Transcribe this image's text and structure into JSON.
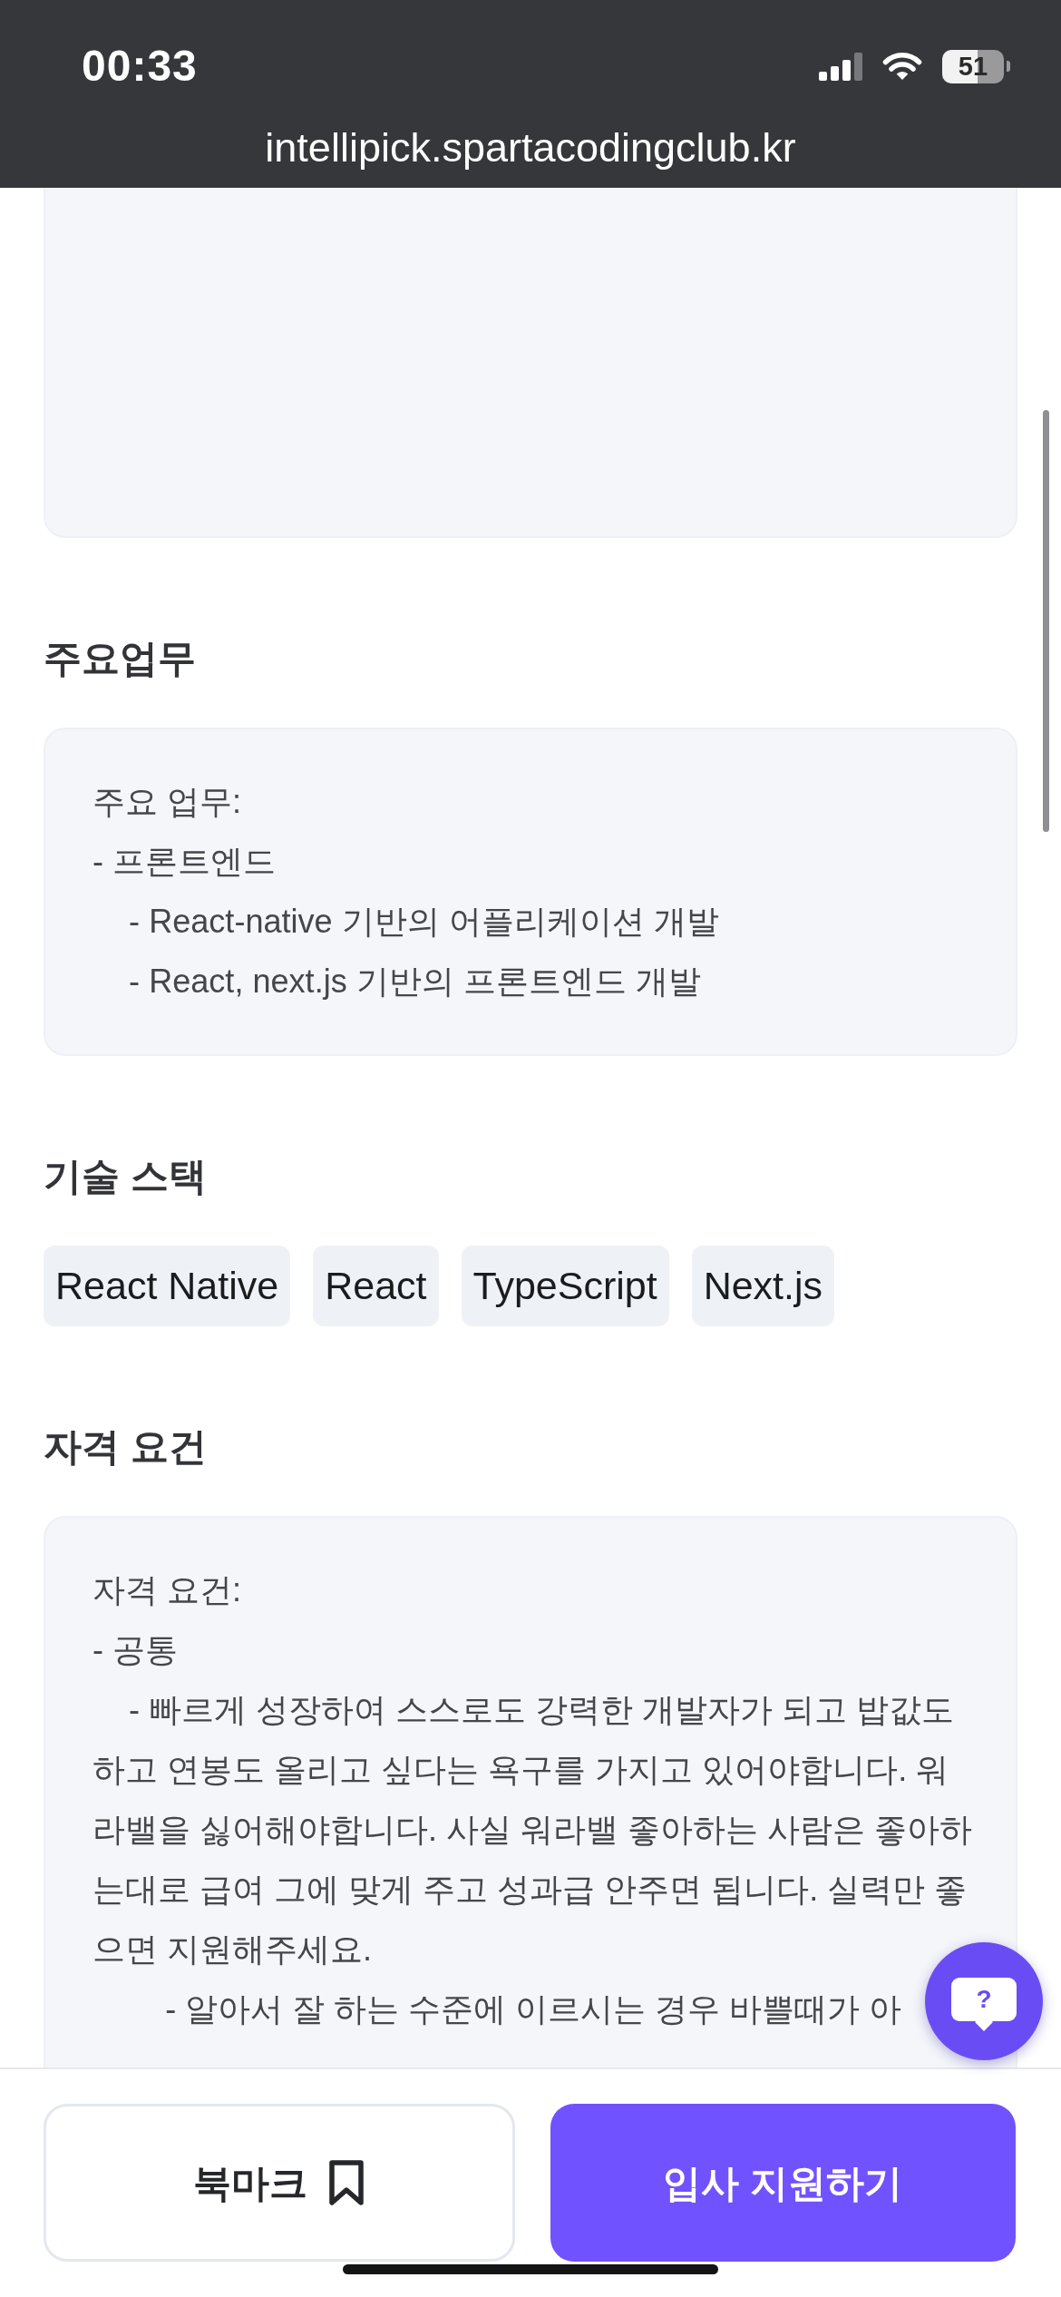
{
  "status_bar": {
    "time": "00:33",
    "battery": "51",
    "url": "intellipick.spartacodingclub.kr"
  },
  "sections": [
    {
      "kind": "card"
    },
    {
      "kind": "card",
      "heading": "주요업무",
      "lines": [
        "주요 업무:",
        "- 프론트엔드",
        "    - React-native 기반의 어플리케이션 개발",
        "    - React, next.js 기반의 프론트엔드 개발"
      ]
    },
    {
      "kind": "tags",
      "heading": "기술 스택",
      "tags": [
        "React Native",
        "React",
        "TypeScript",
        "Next.js"
      ]
    },
    {
      "kind": "card",
      "heading": "자격 요건",
      "lines": [
        "자격 요건:",
        "- 공통",
        "    - 빠르게 성장하여 스스로도 강력한 개발자가 되고 밥값도 하고 연봉도 올리고 싶다는 욕구를 가지고 있어야합니다. 워라밸을 싫어해야합니다. 사실 워라밸 좋아하는 사람은 좋아하는대로 급여 그에 맞게 주고 성과급 안주면 됩니다. 실력만 좋으면 지원해주세요.",
        "        - 알아서 잘 하는 수준에 이르시는 경우 바쁠때가 아"
      ]
    }
  ],
  "help_button": {
    "label": "?"
  },
  "actions": [
    {
      "kind": "bookmark",
      "label": "북마크"
    },
    {
      "kind": "apply",
      "label": "입사 지원하기"
    }
  ]
}
